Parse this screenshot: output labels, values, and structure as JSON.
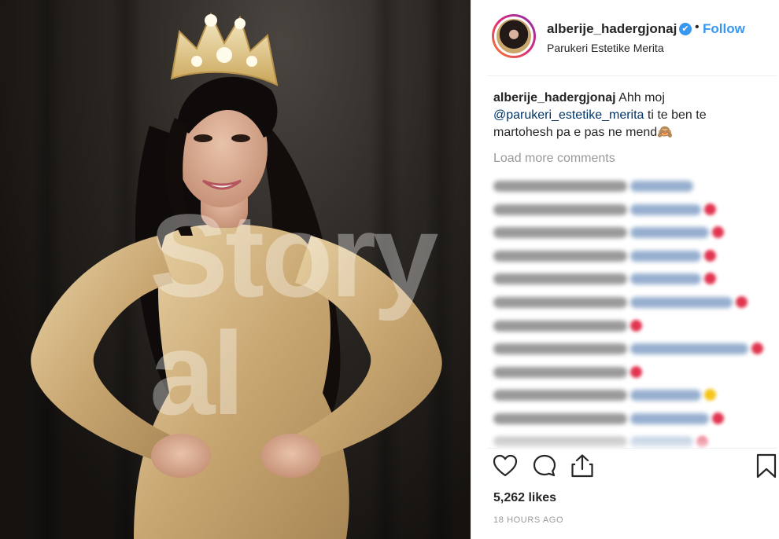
{
  "post": {
    "username": "alberije_hadergjonaj",
    "verified_badge": "✔",
    "separator": "•",
    "follow_label": "Follow",
    "location": "Parukeri Estetike Merita"
  },
  "photo": {
    "watermark": "Story al",
    "description_icon": "photo-of-woman-in-crown"
  },
  "caption": {
    "username": "alberije_hadergjonaj",
    "text_before": " Ahh moj ",
    "mention": "@parukeri_estetike_merita",
    "text_after": " ti te ben te martohesh pa e pas ne mend🙈"
  },
  "load_more_label": "Load more comments",
  "comments": [
    {
      "emoji_color": "",
      "emoji_icon": ""
    },
    {
      "emoji_color": "#e0344f",
      "emoji_icon": "double-heart-icon"
    },
    {
      "emoji_color": "#e0344f",
      "emoji_icon": "heart-icon"
    },
    {
      "emoji_color": "#e0344f",
      "emoji_icon": "heart-icon"
    },
    {
      "emoji_color": "#e0344f",
      "emoji_icon": "heart-icon"
    },
    {
      "emoji_color": "#e0344f",
      "emoji_icon": "heart-icon"
    },
    {
      "emoji_color": "#e0344f",
      "emoji_icon": "heart-icon"
    },
    {
      "emoji_color": "#e0344f",
      "emoji_icon": "heart-icon"
    },
    {
      "emoji_color": "#e0344f",
      "emoji_icon": "heart-icon"
    },
    {
      "emoji_color": "#f5c518",
      "emoji_icon": "smile-icon"
    },
    {
      "emoji_color": "#e0344f",
      "emoji_icon": "heart-icon"
    },
    {
      "emoji_color": "#e0344f",
      "emoji_icon": "heart-icon"
    }
  ],
  "likes": "5,262 likes",
  "timestamp": "18 HOURS AGO",
  "colors": {
    "accent": "#3897f0",
    "text": "#262626",
    "muted": "#999999",
    "mention": "#003569"
  }
}
